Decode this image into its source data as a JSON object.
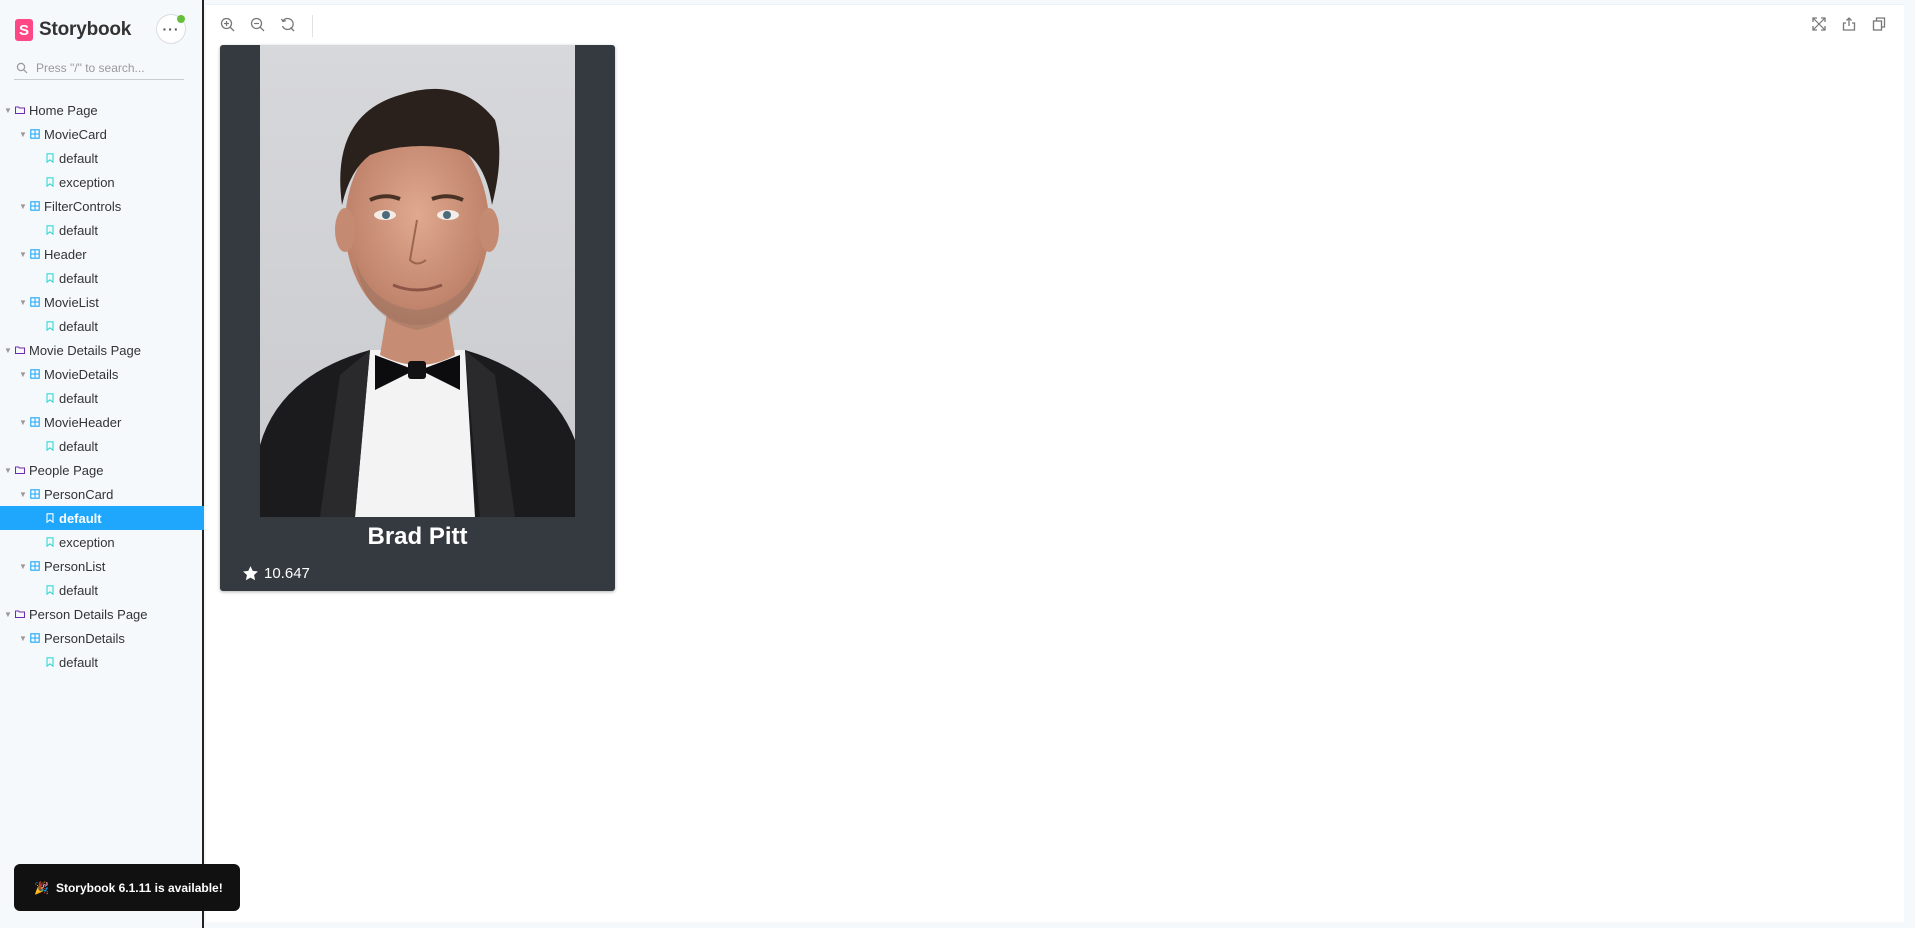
{
  "app": {
    "title": "Storybook",
    "logo_letter": "S"
  },
  "search": {
    "placeholder": "Press \"/\" to search..."
  },
  "tree": [
    {
      "label": "Home Page",
      "kind": "folder",
      "level": 0,
      "expanded": true,
      "selected": false
    },
    {
      "label": "MovieCard",
      "kind": "component",
      "level": 1,
      "expanded": true,
      "selected": false
    },
    {
      "label": "default",
      "kind": "story",
      "level": 2,
      "selected": false
    },
    {
      "label": "exception",
      "kind": "story",
      "level": 2,
      "selected": false
    },
    {
      "label": "FilterControls",
      "kind": "component",
      "level": 1,
      "expanded": true,
      "selected": false
    },
    {
      "label": "default",
      "kind": "story",
      "level": 2,
      "selected": false
    },
    {
      "label": "Header",
      "kind": "component",
      "level": 1,
      "expanded": true,
      "selected": false
    },
    {
      "label": "default",
      "kind": "story",
      "level": 2,
      "selected": false
    },
    {
      "label": "MovieList",
      "kind": "component",
      "level": 1,
      "expanded": true,
      "selected": false
    },
    {
      "label": "default",
      "kind": "story",
      "level": 2,
      "selected": false
    },
    {
      "label": "Movie Details Page",
      "kind": "folder",
      "level": 0,
      "expanded": true,
      "selected": false
    },
    {
      "label": "MovieDetails",
      "kind": "component",
      "level": 1,
      "expanded": true,
      "selected": false
    },
    {
      "label": "default",
      "kind": "story",
      "level": 2,
      "selected": false
    },
    {
      "label": "MovieHeader",
      "kind": "component",
      "level": 1,
      "expanded": true,
      "selected": false
    },
    {
      "label": "default",
      "kind": "story",
      "level": 2,
      "selected": false
    },
    {
      "label": "People Page",
      "kind": "folder",
      "level": 0,
      "expanded": true,
      "selected": false
    },
    {
      "label": "PersonCard",
      "kind": "component",
      "level": 1,
      "expanded": true,
      "selected": false
    },
    {
      "label": "default",
      "kind": "story",
      "level": 2,
      "selected": true
    },
    {
      "label": "exception",
      "kind": "story",
      "level": 2,
      "selected": false
    },
    {
      "label": "PersonList",
      "kind": "component",
      "level": 1,
      "expanded": true,
      "selected": false
    },
    {
      "label": "default",
      "kind": "story",
      "level": 2,
      "selected": false
    },
    {
      "label": "Person Details Page",
      "kind": "folder",
      "level": 0,
      "expanded": true,
      "selected": false
    },
    {
      "label": "PersonDetails",
      "kind": "component",
      "level": 1,
      "expanded": true,
      "selected": false
    },
    {
      "label": "default",
      "kind": "story",
      "level": 2,
      "selected": false
    }
  ],
  "toolbar": {
    "left": [
      "zoom-in-icon",
      "zoom-out-icon",
      "zoom-reset-icon"
    ],
    "right": [
      "fullscreen-icon",
      "share-icon",
      "copy-link-icon"
    ]
  },
  "card": {
    "name": "Brad Pitt",
    "popularity": "10.647",
    "photo_icon": "person-portrait"
  },
  "notification": {
    "text": "Storybook 6.1.11 is available!",
    "icon": "🎉"
  },
  "colors": {
    "brand": "#ff4785",
    "selected": "#1ea7fd",
    "card_bg": "#343a40",
    "folder_icon": "#6f2cac",
    "component_icon": "#1ea7fd",
    "story_icon": "#37d5d3"
  }
}
